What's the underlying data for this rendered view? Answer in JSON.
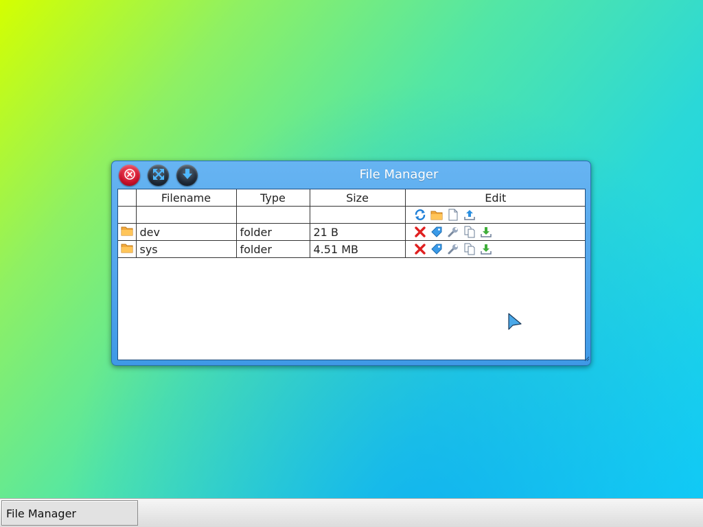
{
  "window": {
    "title": "File Manager"
  },
  "table": {
    "columns": [
      "",
      "Filename",
      "Type",
      "Size",
      "Edit"
    ],
    "toolbar_icons": [
      "refresh-icon",
      "new-folder-icon",
      "new-file-icon",
      "upload-icon"
    ],
    "rows": [
      {
        "icon": "folder-icon",
        "name": "dev",
        "type": "folder",
        "size": "21 B",
        "actions": [
          "delete-icon",
          "rename-tag-icon",
          "wrench-icon",
          "copy-icon",
          "download-icon"
        ]
      },
      {
        "icon": "folder-icon",
        "name": "sys",
        "type": "folder",
        "size": "4.51 MB",
        "actions": [
          "delete-icon",
          "rename-tag-icon",
          "wrench-icon",
          "copy-icon",
          "download-icon"
        ]
      }
    ]
  },
  "taskbar": {
    "items": [
      {
        "label": "File Manager"
      }
    ]
  },
  "colors": {
    "titlebar": "#4aa3ec",
    "close_button": "#c8102a",
    "desktop_start": "#d4ff00",
    "desktop_end": "#12d0f5"
  }
}
